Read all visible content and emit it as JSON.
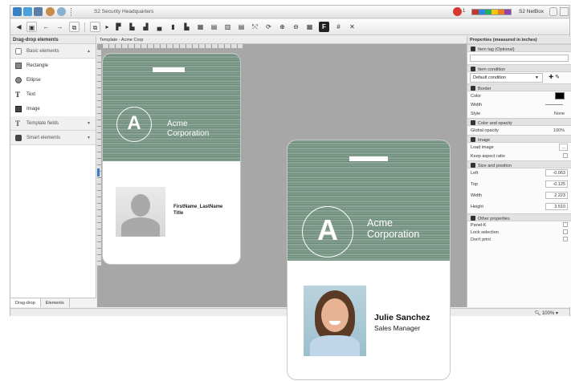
{
  "window": {
    "title": "S2 Security Headquarters",
    "notification_count": "1",
    "product": "S2 NetBox",
    "colorbar": [
      "#c0392b",
      "#2e86de",
      "#27ae60",
      "#f1c40f",
      "#e67e22",
      "#8e44ad"
    ]
  },
  "left_panel": {
    "header": "Drag-drop elements",
    "basic_section": "Basic elements",
    "items": [
      {
        "label": "Rectangle",
        "icon": "rectangle-icon"
      },
      {
        "label": "Ellipse",
        "icon": "ellipse-icon"
      },
      {
        "label": "Text",
        "icon": "text-icon"
      },
      {
        "label": "Image",
        "icon": "image-icon"
      }
    ],
    "template_fields": "Template fields",
    "smart_elements": "Smart elements",
    "tabs": [
      "Drag-drop",
      "Elements"
    ]
  },
  "canvas": {
    "tab_label": "Template - Acme Corp"
  },
  "template_badge": {
    "org_line1": "Acme",
    "org_line2": "Corporation",
    "logo_letter": "A",
    "name_field": "FirstName_LastName",
    "title_field": "Title"
  },
  "preview_badge": {
    "org_line1": "Acme",
    "org_line2": "Corporation",
    "logo_letter": "A",
    "name": "Julie Sanchez",
    "title": "Sales Manager"
  },
  "properties": {
    "header": "Properties (measured in inches)",
    "item_tag_label": "Item tag (Optional)",
    "item_condition_label": "Item condition",
    "condition_value": "Default condition",
    "border_section": "Border",
    "color_label": "Color",
    "width_label": "Width",
    "style_label": "Style",
    "style_value": "None",
    "color_opacity_section": "Color and opacity",
    "global_opacity_label": "Global opacity",
    "global_opacity_value": "100%",
    "image_section": "Image",
    "load_image_label": "Load image",
    "load_image_button": "...",
    "keep_aspect_label": "Keep aspect ratio",
    "size_position_section": "Size and position",
    "left_label": "Left",
    "left_value": "-0.063",
    "top_label": "Top",
    "top_value": "-0.125",
    "width2_label": "Width",
    "width_value": "2.223",
    "height_label": "Height",
    "height_value": "3.510",
    "other_section": "Other properties",
    "panel_k_label": "Panel-K",
    "lock_selection_label": "Lock selection",
    "dont_print_label": "Don't print"
  },
  "status": {
    "zoom": "100%"
  }
}
